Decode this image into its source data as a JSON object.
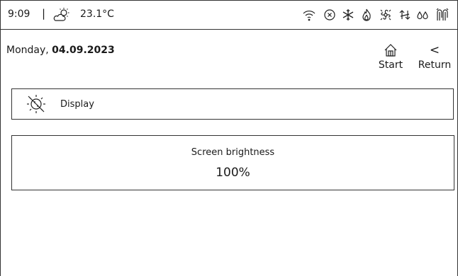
{
  "status_bar": {
    "time": "9:09",
    "separator": "|",
    "temperature": "23.1°C",
    "icons": [
      "partly-sunny-icon",
      "wifi-icon",
      "alarm-x-icon",
      "snowflake-icon",
      "flame-icon",
      "fan-icon",
      "arrows-updown-icon",
      "drops-icon",
      "tubes-icon"
    ]
  },
  "header": {
    "date_weekday": "Monday, ",
    "date_value": "04.09.2023",
    "start_label": "Start",
    "return_label": "Return",
    "return_glyph": "<"
  },
  "display_row": {
    "label": "Display",
    "icon": "brightness-off-icon"
  },
  "brightness": {
    "title": "Screen brightness",
    "value": "100%"
  }
}
